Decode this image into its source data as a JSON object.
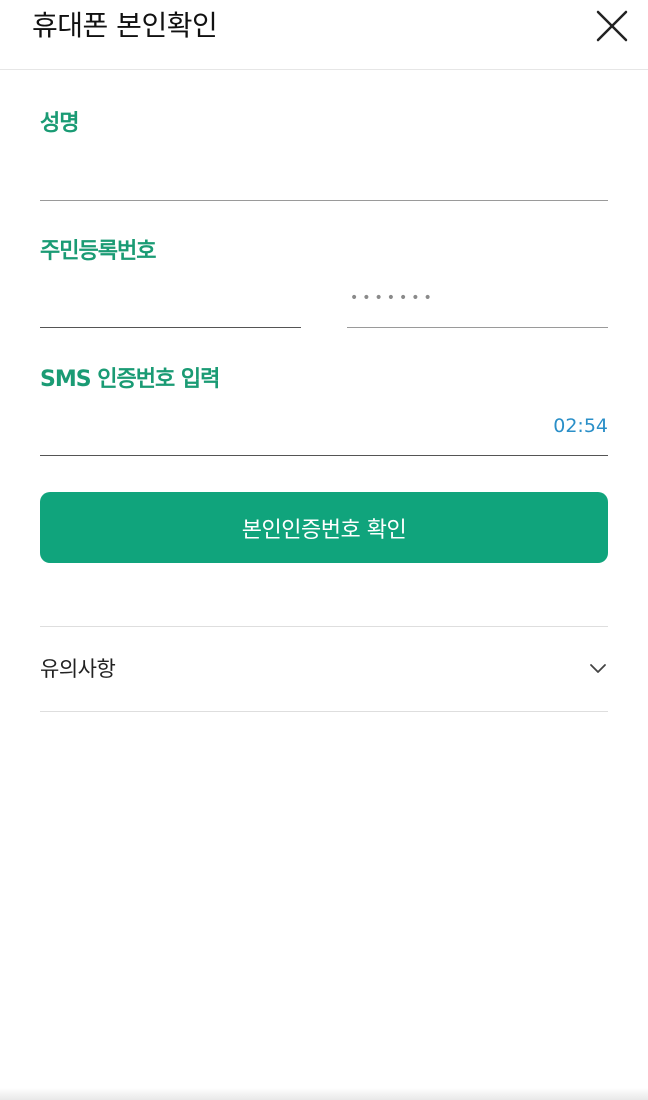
{
  "header": {
    "title": "휴대폰 본인확인",
    "close_icon": "close-icon"
  },
  "form": {
    "name_label": "성명",
    "name_value": "",
    "resident_label": "주민등록번호",
    "resident_front_value": "",
    "resident_back_masked": "•••••••",
    "sms_label": "SMS 인증번호 입력",
    "sms_value": "",
    "timer": "02:54"
  },
  "confirm_button": "본인인증번호 확인",
  "notice": {
    "label": "유의사항",
    "icon": "chevron-down-icon"
  },
  "colors": {
    "accent": "#1a9b74",
    "button": "#10a47c",
    "timer": "#2a8fc8"
  }
}
